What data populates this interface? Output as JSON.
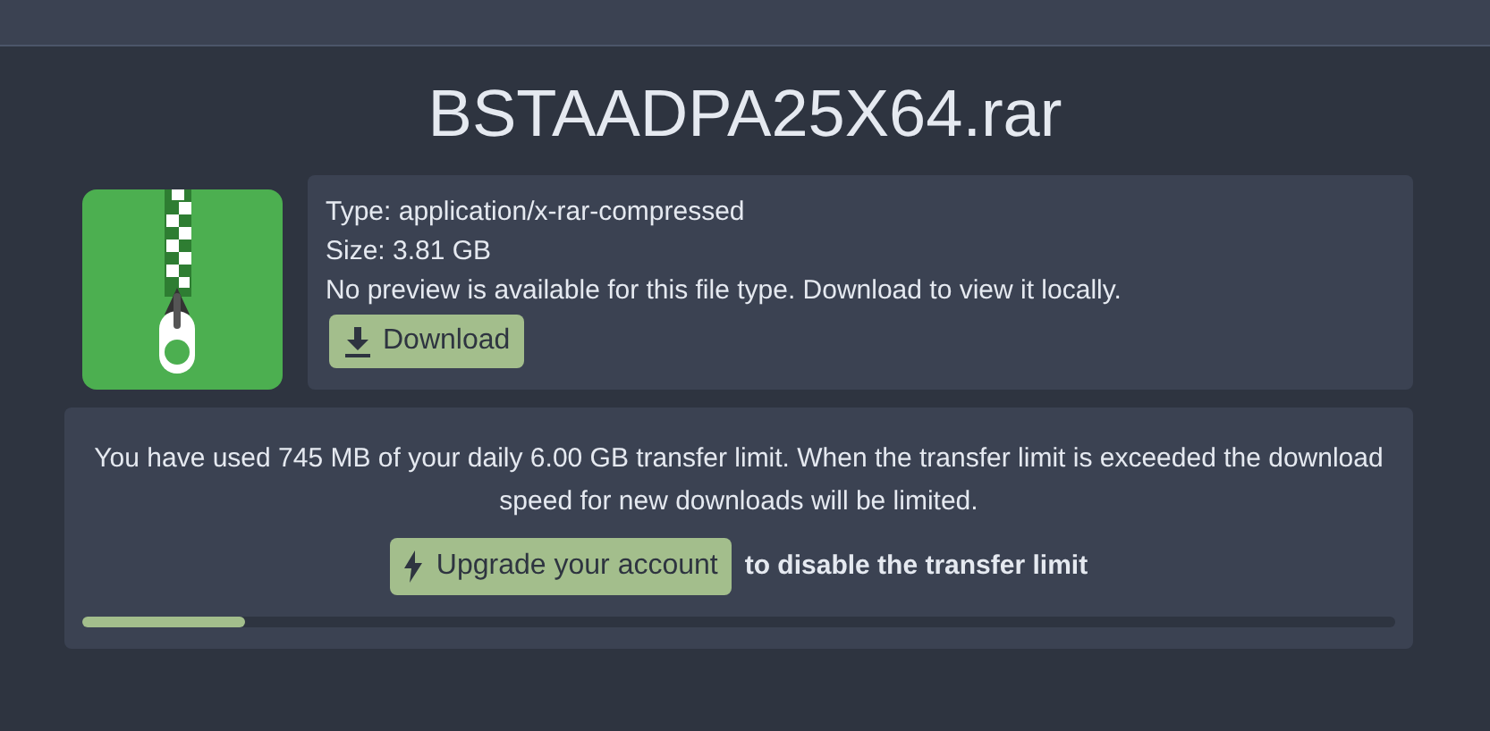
{
  "title": "BSTAADPA25X64.rar",
  "file": {
    "type": "Type: application/x-rar-compressed",
    "size": "Size: 3.81 GB",
    "note": "No preview is available for this file type. Download to view it locally.",
    "download": "Download"
  },
  "transfer": {
    "message": "You have used 745 MB of your daily 6.00 GB transfer limit. When the transfer limit is exceeded the download speed for new downloads will be limited.",
    "upgrade": "Upgrade your account",
    "suffix": "to disable the transfer limit",
    "level": 0.124
  }
}
